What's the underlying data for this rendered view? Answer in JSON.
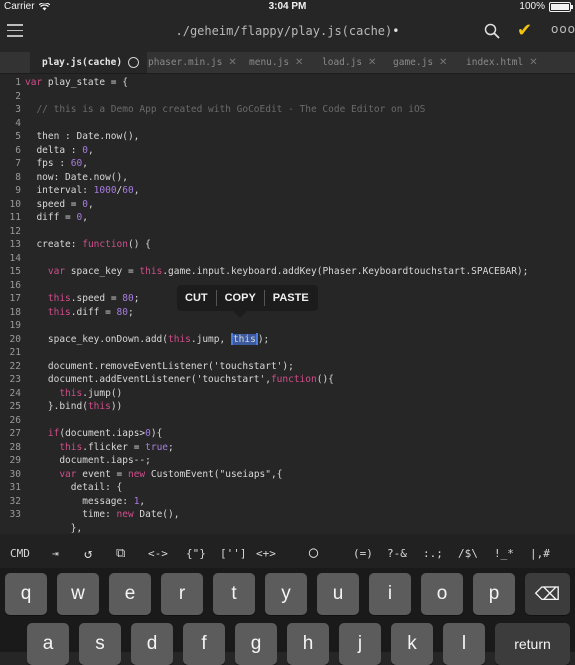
{
  "status": {
    "carrier": "Carrier",
    "time": "3:04 PM",
    "battery": "100%"
  },
  "nav": {
    "title": "./geheim/flappy/play.js(cache)",
    "modified_dot": "•"
  },
  "tabs": [
    {
      "label": "play.js(cache)",
      "active": true
    },
    {
      "label": "phaser.min.js"
    },
    {
      "label": "menu.js"
    },
    {
      "label": "load.js"
    },
    {
      "label": "game.js"
    },
    {
      "label": "index.html"
    }
  ],
  "code": {
    "line_numbers": [
      "1",
      "2",
      "3",
      "4",
      "5",
      "6",
      "7",
      "8",
      "9",
      "10",
      "11",
      "12",
      "13",
      "14",
      "15",
      "16",
      "17",
      "18",
      "19",
      "20",
      "21",
      "22",
      "23",
      "24",
      "25",
      "26",
      "27",
      "28",
      "29",
      "30",
      "31",
      "32",
      "33"
    ],
    "l1a": "var",
    "l1b": " play_state = {",
    "l3": "// this is a Demo App created with GoCoEdit - The Code Editor on iOS",
    "l5": "then : Date.now(),",
    "l6a": "delta : ",
    "l6b": "0",
    "l6c": ",",
    "l7a": "fps : ",
    "l7b": "60",
    "l7c": ",",
    "l8": "now: Date.now(),",
    "l9a": "interval: ",
    "l9b": "1000",
    "l9c": "/",
    "l9d": "60",
    "l9e": ",",
    "l10a": "speed = ",
    "l10b": "0",
    "l10c": ",",
    "l11a": "diff = ",
    "l11b": "0",
    "l11c": ",",
    "l13a": "create: ",
    "l13b": "function",
    "l13c": "() {",
    "l15a": "var",
    "l15b": " space_key = ",
    "l15c": "this",
    "l15d": ".game.input.keyboard.addKey(Phaser.Keyboardtouchstart.SPACEBAR);",
    "l17a": "this",
    "l17b": ".speed = ",
    "l17c": "80",
    "l17d": ";",
    "l18a": "this",
    "l18b": ".diff = ",
    "l18c": "80",
    "l18d": ";",
    "l20a": "space_key.onDown.add(",
    "l20b": "this",
    "l20c": ".jump, ",
    "l20d": "this",
    "l20e": ");",
    "l22": "document.removeEventListener('touchstart');",
    "l23a": "document.addEventListener('touchstart',",
    "l23b": "function",
    "l23c": "(){",
    "l24a": "this",
    "l24b": ".jump()",
    "l25a": "}.bind(",
    "l25b": "this",
    "l25c": "))",
    "l27a": "if",
    "l27b": "(document.iaps>",
    "l27c": "0",
    "l27d": "){",
    "l28a": "this",
    "l28b": ".flicker = ",
    "l28c": "true",
    "l28d": ";",
    "l29": "document.iaps--;",
    "l30a": "var",
    "l30b": " event = ",
    "l30c": "new",
    "l30d": " CustomEvent(\"useiaps\",{",
    "l31": "detail: {",
    "l32a": "message: ",
    "l32b": "1",
    "l32c": ",",
    "l33a": "time: ",
    "l33b": "new",
    "l33c": " Date(),",
    "l34": "},"
  },
  "context_menu": {
    "cut": "CUT",
    "copy": "COPY",
    "paste": "PASTE"
  },
  "accessory": {
    "cmd": "CMD",
    "tab": "⇥",
    "undo": "↺",
    "clipboard": "⧉",
    "k1": "<->",
    "k2": "{\"}",
    "k3": "['']",
    "k4": "<+>",
    "k5": "◯",
    "k6": "(=)",
    "k7": "?-&",
    "k8": ":.;",
    "k9": "/$\\",
    "k10": "!_*",
    "k11": "|,#"
  },
  "keyboard": {
    "row1": [
      "q",
      "w",
      "e",
      "r",
      "t",
      "y",
      "u",
      "i",
      "o",
      "p"
    ],
    "row2": [
      "a",
      "s",
      "d",
      "f",
      "g",
      "h",
      "j",
      "k",
      "l"
    ],
    "backspace": "⌫",
    "return": "return"
  }
}
